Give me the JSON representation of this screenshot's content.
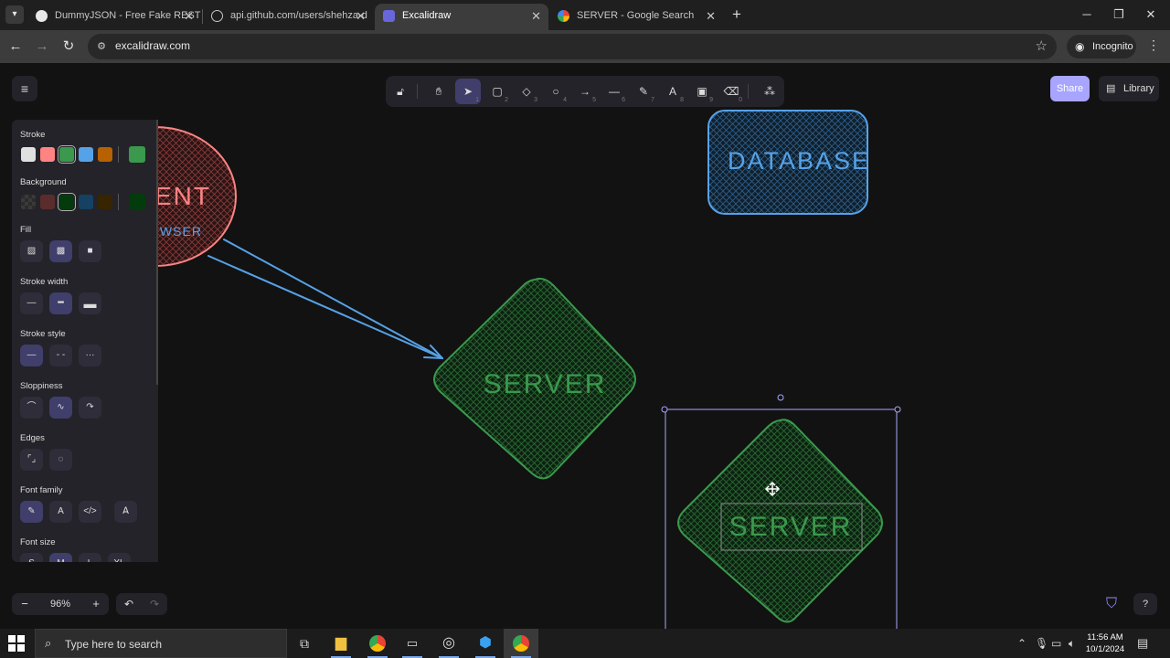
{
  "browser": {
    "tabs": [
      {
        "title": "DummyJSON - Free Fake REST",
        "active": false
      },
      {
        "title": "api.github.com/users/shehza-d",
        "active": false
      },
      {
        "title": "Excalidraw",
        "active": true
      },
      {
        "title": "SERVER - Google Search",
        "active": false
      }
    ],
    "close_glyph": "✕",
    "new_tab_glyph": "+",
    "url": "excalidraw.com",
    "incognito_label": "Incognito"
  },
  "excalidraw": {
    "tool_shortcuts": [
      "",
      "",
      "1",
      "2",
      "3",
      "4",
      "5",
      "6",
      "7",
      "8",
      "9",
      "0",
      ""
    ],
    "share_label": "Share",
    "library_label": "Library",
    "properties": {
      "stroke_label": "Stroke",
      "background_label": "Background",
      "fill_label": "Fill",
      "stroke_width_label": "Stroke width",
      "stroke_style_label": "Stroke style",
      "sloppiness_label": "Sloppiness",
      "edges_label": "Edges",
      "font_family_label": "Font family",
      "font_size_label": "Font size",
      "font_sizes": [
        "S",
        "M",
        "L",
        "XL"
      ]
    },
    "stroke_colors": [
      "#e0e0e0",
      "#ff8383",
      "#3a994c",
      "#56a2e8",
      "#b76100",
      "#3a994c"
    ],
    "background_colors": [
      "#2b2b2b",
      "#5b2c2c",
      "#043b0c",
      "#154163",
      "#362500",
      "#043b0c"
    ],
    "zoom": "96%",
    "zoom_out": "−",
    "zoom_in": "+",
    "canvas": {
      "client_text": "ENT",
      "browser_text": "OWSER",
      "database_text": "DATABASE",
      "server_text": "SERVER",
      "server_copy_text": "SERVER"
    },
    "colors": {
      "red": "#ff8383",
      "blue": "#56a2e8",
      "green": "#3a994c",
      "accent": "#a8a5ff"
    }
  },
  "taskbar": {
    "search_placeholder": "Type here to search",
    "time": "11:56 AM",
    "date": "10/1/2024"
  }
}
